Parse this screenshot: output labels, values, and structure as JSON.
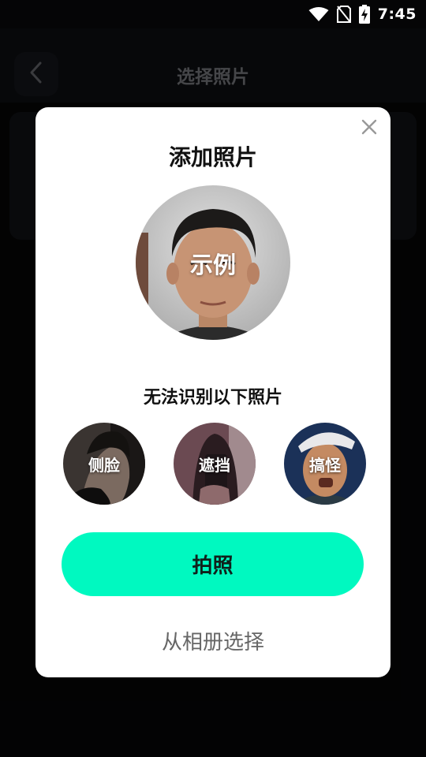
{
  "status_bar": {
    "time": "7:45",
    "icons": [
      "wifi-icon",
      "no-sim-icon",
      "battery-charging-icon"
    ]
  },
  "page": {
    "title": "选择照片",
    "back_icon": "chevron-left-icon"
  },
  "dialog": {
    "title": "添加照片",
    "close_icon": "close-icon",
    "example_label": "示例",
    "unrecognizable_heading": "无法识别以下照片",
    "bad_examples": [
      {
        "label": "侧脸"
      },
      {
        "label": "遮挡"
      },
      {
        "label": "搞怪"
      }
    ],
    "take_photo_label": "拍照",
    "choose_from_album_label": "从相册选择"
  },
  "colors": {
    "accent": "#00f9c0",
    "dialog_bg": "#ffffff",
    "page_bg": "#050506"
  }
}
